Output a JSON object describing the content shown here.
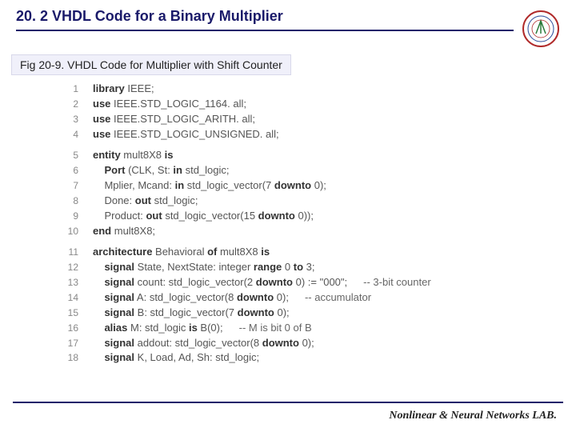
{
  "title": "20. 2 VHDL Code for a Binary Multiplier",
  "figCaption": "Fig 20-9. VHDL Code for Multiplier with Shift Counter",
  "footer": "Nonlinear & Neural Networks LAB.",
  "code": [
    {
      "n": "1",
      "pre": "",
      "kw": "library",
      "rest": " IEEE;",
      "cmt": ""
    },
    {
      "n": "2",
      "pre": "",
      "kw": "use",
      "rest": " IEEE.STD_LOGIC_1164. all;",
      "cmt": ""
    },
    {
      "n": "3",
      "pre": "",
      "kw": "use",
      "rest": " IEEE.STD_LOGIC_ARITH. all;",
      "cmt": ""
    },
    {
      "n": "4",
      "pre": "",
      "kw": "use",
      "rest": " IEEE.STD_LOGIC_UNSIGNED. all;",
      "cmt": ""
    },
    {
      "gap": true
    },
    {
      "n": "5",
      "pre": "",
      "kw": "entity",
      "rest": " mult8X8 ",
      "kw2": "is",
      "rest2": "",
      "cmt": ""
    },
    {
      "n": "6",
      "pre": "    ",
      "kw": "Port",
      "rest": " (CLK, St: ",
      "kw2": "in",
      "rest2": " std_logic;",
      "cmt": ""
    },
    {
      "n": "7",
      "pre": "    ",
      "kw": "",
      "rest": "Mplier, Mcand: ",
      "kw2": "in",
      "rest2": " std_logic_vector(7 ",
      "kw3": "downto",
      "rest3": " 0);",
      "cmt": ""
    },
    {
      "n": "8",
      "pre": "    ",
      "kw": "",
      "rest": "Done: ",
      "kw2": "out",
      "rest2": " std_logic;",
      "cmt": ""
    },
    {
      "n": "9",
      "pre": "    ",
      "kw": "",
      "rest": "Product: ",
      "kw2": "out",
      "rest2": " std_logic_vector(15 ",
      "kw3": "downto",
      "rest3": " 0));",
      "cmt": ""
    },
    {
      "n": "10",
      "pre": "",
      "kw": "end",
      "rest": " mult8X8;",
      "cmt": ""
    },
    {
      "gap": true
    },
    {
      "n": "11",
      "pre": "",
      "kw": "architecture",
      "rest": " Behavioral ",
      "kw2": "of",
      "rest2": " mult8X8 ",
      "kw3": "is",
      "rest3": "",
      "cmt": ""
    },
    {
      "n": "12",
      "pre": "    ",
      "kw": "signal",
      "rest": " State, NextState: integer ",
      "kw2": "range",
      "rest2": " 0 ",
      "kw3": "to",
      "rest3": " 3;",
      "cmt": ""
    },
    {
      "n": "13",
      "pre": "    ",
      "kw": "signal",
      "rest": " count: std_logic_vector(2 ",
      "kw2": "downto",
      "rest2": " 0) := \"000\";",
      "cmt": "-- 3-bit counter"
    },
    {
      "n": "14",
      "pre": "    ",
      "kw": "signal",
      "rest": " A: std_logic_vector(8 ",
      "kw2": "downto",
      "rest2": " 0);",
      "cmt": "-- accumulator"
    },
    {
      "n": "15",
      "pre": "    ",
      "kw": "signal",
      "rest": " B: std_logic_vector(7 ",
      "kw2": "downto",
      "rest2": " 0);",
      "cmt": ""
    },
    {
      "n": "16",
      "pre": "    ",
      "kw": "alias",
      "rest": " M: std_logic ",
      "kw2": "is",
      "rest2": " B(0);",
      "cmt": "-- M is bit 0 of B"
    },
    {
      "n": "17",
      "pre": "    ",
      "kw": "signal",
      "rest": " addout: std_logic_vector(8 ",
      "kw2": "downto",
      "rest2": " 0);",
      "cmt": ""
    },
    {
      "n": "18",
      "pre": "    ",
      "kw": "signal",
      "rest": " K, Load, Ad, Sh: std_logic;",
      "cmt": ""
    }
  ]
}
